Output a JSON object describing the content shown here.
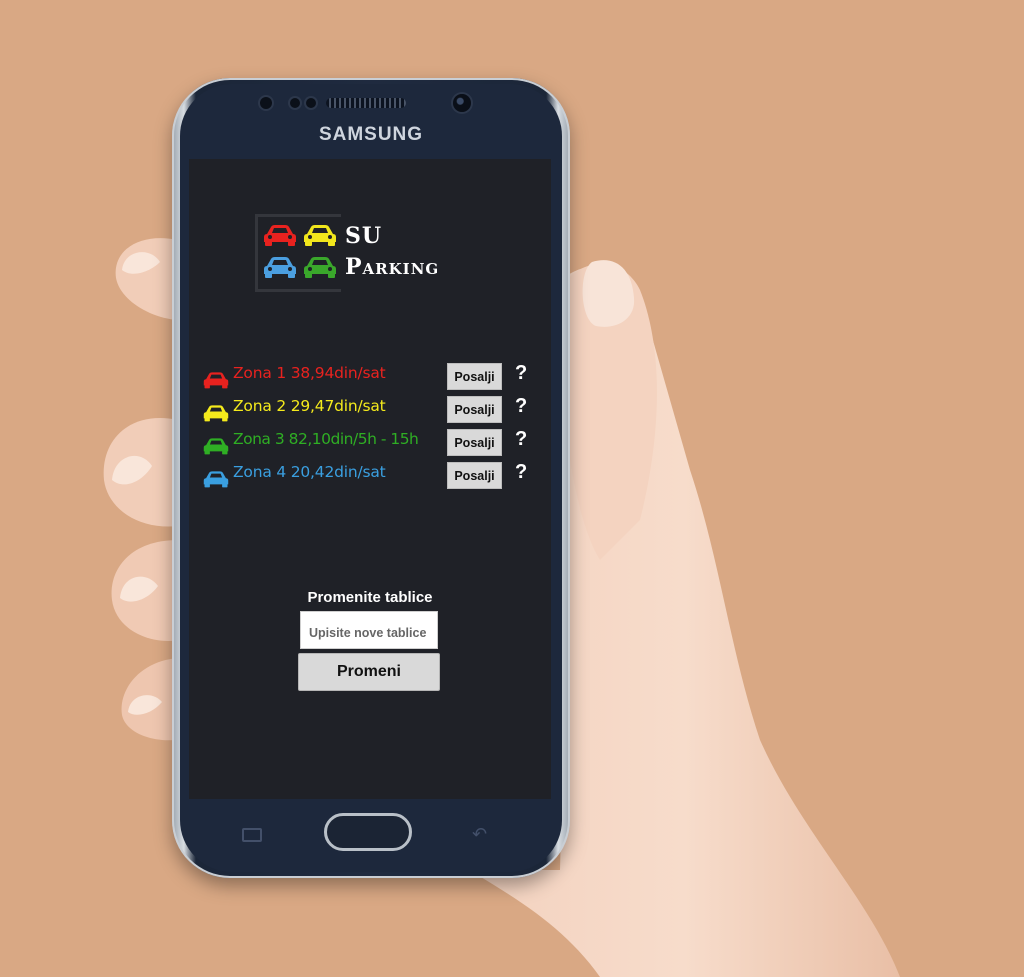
{
  "device": {
    "brand": "SAMSUNG"
  },
  "app": {
    "logo": {
      "line1": "SU",
      "line2": "Parking",
      "car_colors": [
        "#e8221f",
        "#f1e61c",
        "#4b9fe0",
        "#3aa72b"
      ]
    },
    "zones": [
      {
        "label": "Zona 1  38,94din/sat",
        "color": "#e8221f",
        "button": "Posalji",
        "help": "?"
      },
      {
        "label": "Zona 2 29,47din/sat",
        "color": "#f4ea1c",
        "button": "Posalji",
        "help": "?"
      },
      {
        "label": "Zona 3 82,10din/5h - 15h",
        "color": "#2fae24",
        "button": "Posalji",
        "help": "?"
      },
      {
        "label": "Zona 4 20,42din/sat",
        "color": "#3a9fe0",
        "button": "Posalji",
        "help": "?"
      }
    ],
    "plates": {
      "title": "Promenite tablice",
      "placeholder": "Upisite nove tablice",
      "button": "Promeni"
    }
  },
  "icons": {
    "car": "car-icon",
    "help": "question-mark-icon",
    "home": "home-button",
    "recent": "recent-apps-icon",
    "back": "back-icon"
  }
}
